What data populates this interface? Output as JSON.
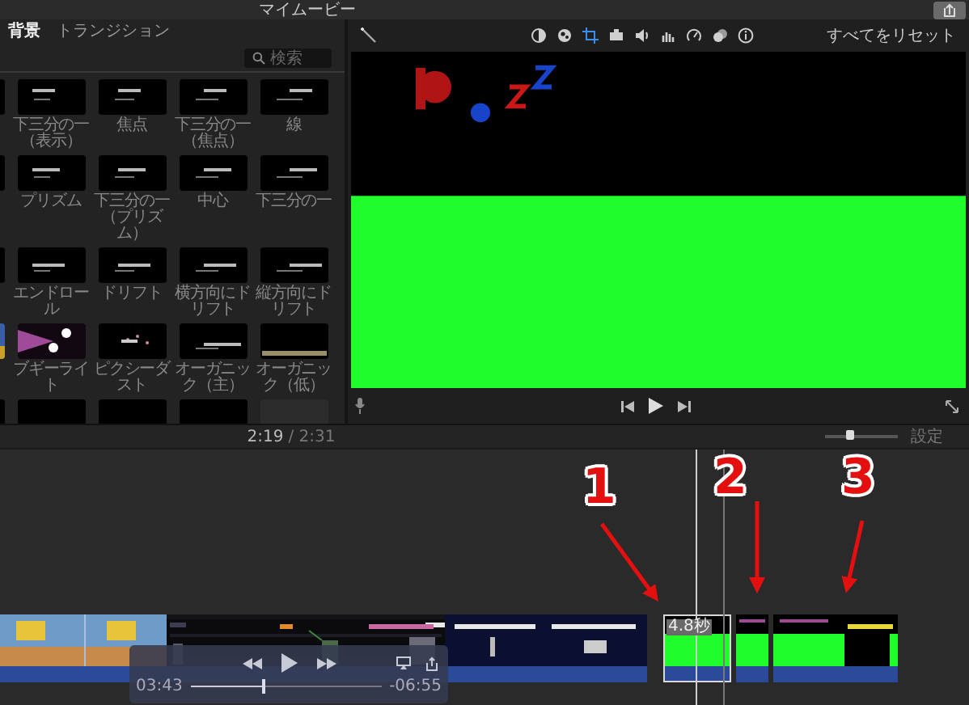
{
  "window": {
    "title": "マイムービー"
  },
  "browser": {
    "tabs": [
      {
        "label": "背景",
        "selected": true
      },
      {
        "label": "トランジション",
        "selected": false
      }
    ],
    "search": {
      "placeholder": "検索"
    },
    "titles": [
      {
        "kind": "cut"
      },
      {
        "kind": "title",
        "label": "下三分の一（表示）"
      },
      {
        "kind": "title",
        "label": "焦点"
      },
      {
        "kind": "title",
        "label": "下三分の一（焦点）"
      },
      {
        "kind": "title",
        "label": "線"
      },
      {
        "kind": "cut"
      },
      {
        "kind": "title",
        "label": "プリズム"
      },
      {
        "kind": "title",
        "label": "下三分の一（プリズム）"
      },
      {
        "kind": "title",
        "label": "中心"
      },
      {
        "kind": "title",
        "label": "下三分の一"
      },
      {
        "kind": "cut"
      },
      {
        "kind": "title",
        "label": "エンドロール"
      },
      {
        "kind": "title",
        "label": "ドリフト"
      },
      {
        "kind": "title",
        "label": "横方向にドリフト"
      },
      {
        "kind": "title",
        "label": "縦方向にドリフト"
      },
      {
        "kind": "cut"
      },
      {
        "kind": "title",
        "label": "ブギーライト"
      },
      {
        "kind": "title",
        "label": "ピクシーダスト"
      },
      {
        "kind": "title",
        "label": "オーガニック（主）"
      },
      {
        "kind": "title",
        "label": "オーガニック（低）"
      },
      {
        "kind": "cut"
      },
      {
        "kind": "cut"
      },
      {
        "kind": "cut"
      },
      {
        "kind": "cut"
      },
      {
        "kind": "cut"
      }
    ]
  },
  "viewer": {
    "tools": [
      {
        "kind": "color-balance",
        "selected": false
      },
      {
        "kind": "color-correction",
        "selected": false
      },
      {
        "kind": "crop",
        "selected": true
      },
      {
        "kind": "stabilization",
        "selected": false
      },
      {
        "kind": "volume",
        "selected": false
      },
      {
        "kind": "noise-reduction",
        "selected": false
      },
      {
        "kind": "speed",
        "selected": false
      },
      {
        "kind": "filter",
        "selected": false
      },
      {
        "kind": "info",
        "selected": false
      }
    ],
    "reset": "すべてをリセット"
  },
  "timeline": {
    "current": "2:19",
    "total": "/ 2:31",
    "zoom": {
      "level": 0.33
    },
    "settings": "設定",
    "clips": [
      {
        "kind": "picture",
        "selected": false
      },
      {
        "kind": "picture",
        "selected": false
      },
      {
        "kind": "picture",
        "selected": false
      },
      {
        "kind": "picture",
        "selected": true,
        "duration": "4.8秒"
      },
      {
        "kind": "picture",
        "selected": false
      },
      {
        "kind": "picture",
        "selected": false
      }
    ],
    "annotations": [
      "1",
      "2",
      "3"
    ]
  },
  "player": {
    "elapsed": "03:43",
    "remaining": "-06:55",
    "level": 0.38
  }
}
